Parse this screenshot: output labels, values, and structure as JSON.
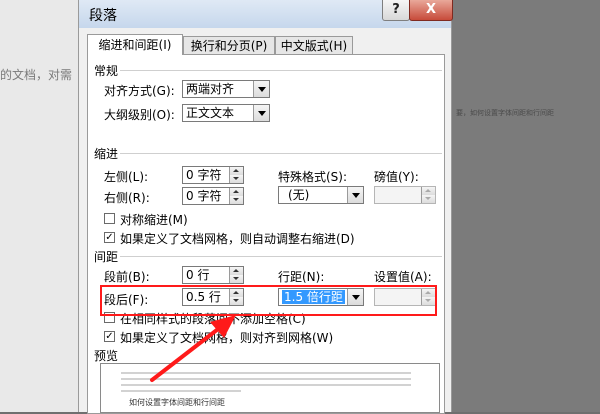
{
  "background": {
    "left_text": "的文档，对需",
    "right_text": "要，如何设置字体间距和行间距"
  },
  "dialog": {
    "title": "段落",
    "help_label": "?",
    "close_label": "X"
  },
  "tabs": [
    {
      "label": "缩进和间距(I)"
    },
    {
      "label": "换行和分页(P)"
    },
    {
      "label": "中文版式(H)"
    }
  ],
  "general": {
    "section": "常规",
    "alignment_label": "对齐方式(G):",
    "alignment_value": "两端对齐",
    "outline_label": "大纲级别(O):",
    "outline_value": "正文文本"
  },
  "indent": {
    "section": "缩进",
    "left_label": "左侧(L):",
    "left_value": "0 字符",
    "right_label": "右侧(R):",
    "right_value": "0 字符",
    "special_label": "特殊格式(S):",
    "special_value": "(无)",
    "by_label": "磅值(Y):",
    "by_value": "",
    "mirror_label": "对称缩进(M)",
    "auto_adjust_label": "如果定义了文档网格，则自动调整右缩进(D)"
  },
  "spacing": {
    "section": "间距",
    "before_label": "段前(B):",
    "before_value": "0 行",
    "after_label": "段后(F):",
    "after_value": "0.5 行",
    "line_label": "行距(N):",
    "line_value": "1.5 倍行距",
    "at_label": "设置值(A):",
    "at_value": "",
    "no_space_label": "在相同样式的段落间不添加空格(C)",
    "snap_label": "如果定义了文档网格，则对齐到网格(W)"
  },
  "preview": {
    "section": "预览",
    "sample_text": "如何设置字体间距和行间距"
  },
  "colors": {
    "highlight": "#ff1a1a",
    "selection": "#3399ff"
  }
}
